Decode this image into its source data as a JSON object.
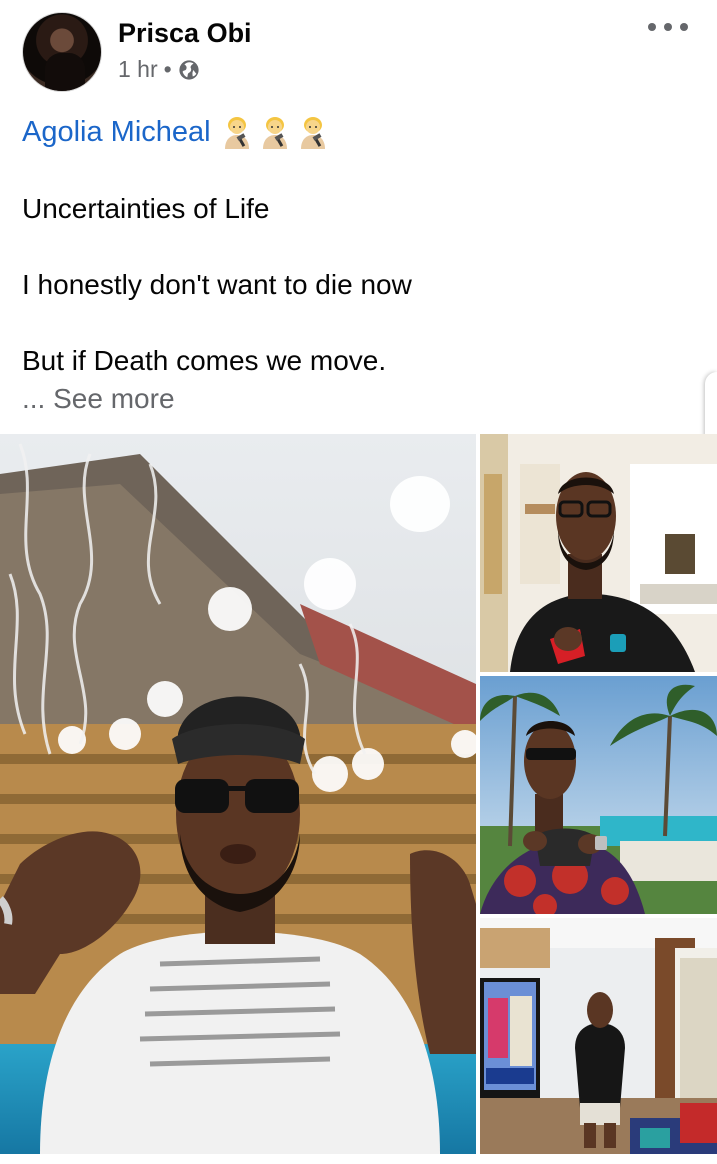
{
  "post": {
    "author": "Prisca Obi",
    "time": "1 hr",
    "separator": "•",
    "privacy_icon": "globe-icon",
    "more_icon": "more-options-icon",
    "mention": "Agolia Micheal",
    "mention_emojis": [
      "woman-judge-emoji",
      "woman-judge-emoji",
      "woman-judge-emoji"
    ],
    "lines": [
      "Uncertainties of Life",
      "I honestly don't want to die now",
      "But if Death comes we move."
    ],
    "ellipsis": "...",
    "see_more": "See more"
  },
  "colors": {
    "mention": "#1b66c9",
    "secondary_text": "#65676b",
    "primary_text": "#050505"
  },
  "photos": [
    {
      "name": "photo-man-white-shirt-sunglasses"
    },
    {
      "name": "photo-man-black-shirt-red-cup"
    },
    {
      "name": "photo-man-red-patterned-shirt-palms"
    },
    {
      "name": "photo-man-living-room-tv"
    }
  ]
}
